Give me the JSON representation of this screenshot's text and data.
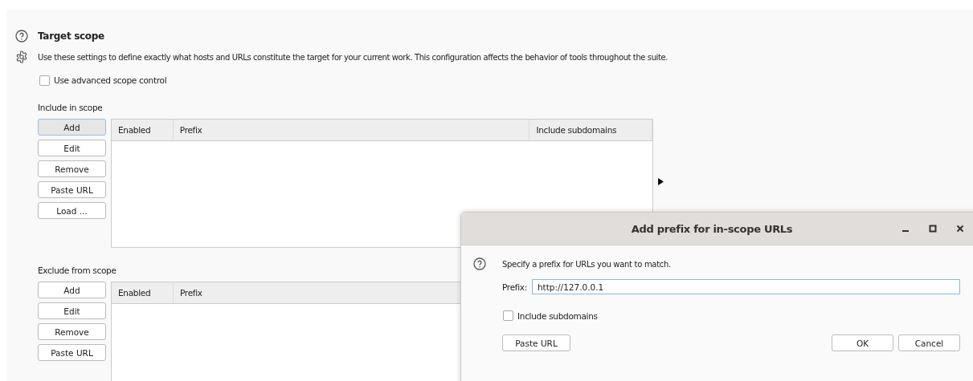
{
  "section": {
    "title": "Target scope",
    "description": "Use these settings to define exactly what hosts and URLs constitute the target for your current work. This configuration affects the behavior of tools throughout the suite.",
    "advanced_scope": {
      "label": "Use advanced scope control",
      "checked": false
    }
  },
  "include": {
    "label": "Include in scope",
    "buttons": [
      {
        "label": "Add",
        "selected": true
      },
      {
        "label": "Edit",
        "selected": false
      },
      {
        "label": "Remove",
        "selected": false
      },
      {
        "label": "Paste URL",
        "selected": false
      },
      {
        "label": "Load ...",
        "selected": false
      }
    ],
    "columns": [
      "Enabled",
      "Prefix",
      "Include subdomains"
    ]
  },
  "exclude": {
    "label": "Exclude from scope",
    "buttons": [
      {
        "label": "Add",
        "selected": false
      },
      {
        "label": "Edit",
        "selected": false
      },
      {
        "label": "Remove",
        "selected": false
      },
      {
        "label": "Paste URL",
        "selected": false
      }
    ],
    "columns": [
      "Enabled",
      "Prefix"
    ]
  },
  "dialog": {
    "title": "Add prefix for in-scope URLs",
    "message": "Specify a prefix for URLs you want to match.",
    "prefix_label": "Prefix:",
    "prefix_value": "http://127.0.0.1",
    "include_subdomains": {
      "label": "Include subdomains",
      "checked": false
    },
    "buttons": [
      "Paste URL",
      "OK",
      "Cancel"
    ]
  }
}
